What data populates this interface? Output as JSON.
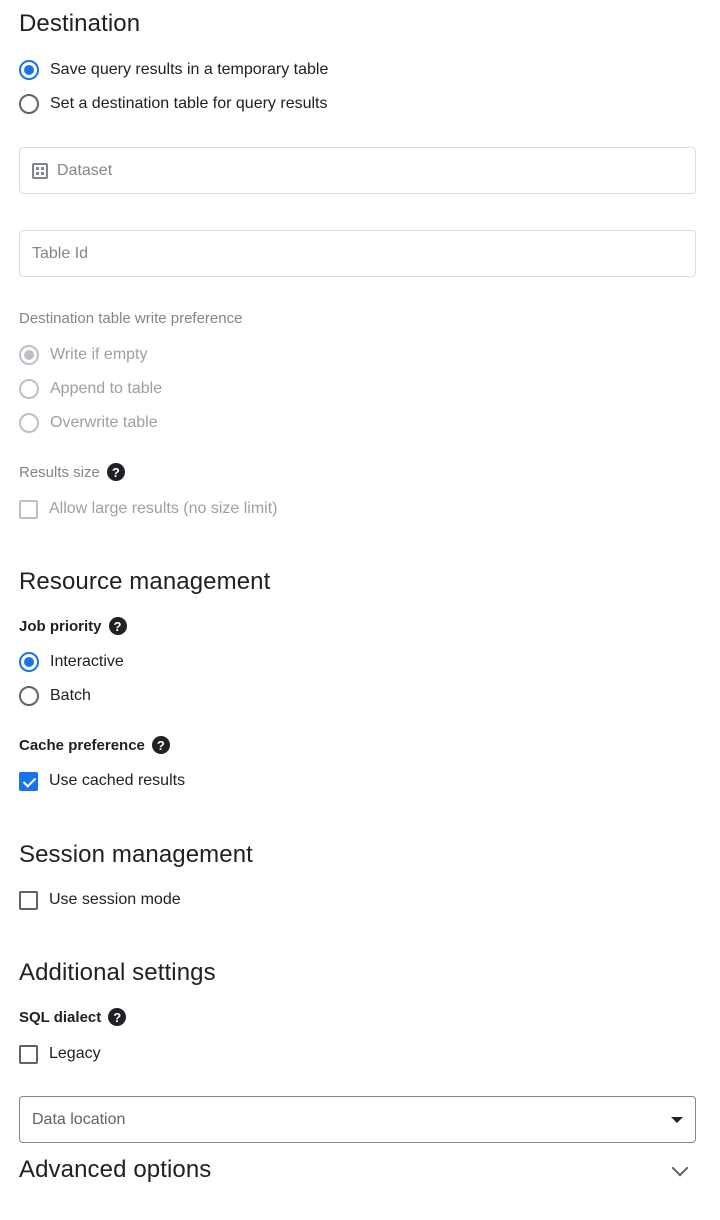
{
  "destination": {
    "heading": "Destination",
    "options": [
      {
        "label": "Save query results in a temporary table",
        "selected": true
      },
      {
        "label": "Set a destination table for query results",
        "selected": false
      }
    ],
    "dataset_placeholder": "Dataset",
    "table_id_placeholder": "Table Id",
    "write_pref": {
      "label": "Destination table write preference",
      "options": [
        {
          "label": "Write if empty",
          "selected": true
        },
        {
          "label": "Append to table",
          "selected": false
        },
        {
          "label": "Overwrite table",
          "selected": false
        }
      ]
    },
    "results_size": {
      "label": "Results size",
      "help_icon": "?",
      "checkbox_label": "Allow large results (no size limit)",
      "checked": false
    }
  },
  "resource": {
    "heading": "Resource management",
    "job_priority": {
      "label": "Job priority",
      "help_icon": "?",
      "options": [
        {
          "label": "Interactive",
          "selected": true
        },
        {
          "label": "Batch",
          "selected": false
        }
      ]
    },
    "cache": {
      "label": "Cache preference",
      "help_icon": "?",
      "checkbox_label": "Use cached results",
      "checked": true
    }
  },
  "session": {
    "heading": "Session management",
    "checkbox_label": "Use session mode",
    "checked": false
  },
  "additional": {
    "heading": "Additional settings",
    "sql_dialect": {
      "label": "SQL dialect",
      "help_icon": "?",
      "checkbox_label": "Legacy",
      "checked": false
    },
    "data_location_placeholder": "Data location"
  },
  "advanced": {
    "heading": "Advanced options"
  },
  "colors": {
    "accent": "#1a73e8",
    "text": "#202124",
    "disabled": "#9aa0a6",
    "border": "#dadce0"
  }
}
